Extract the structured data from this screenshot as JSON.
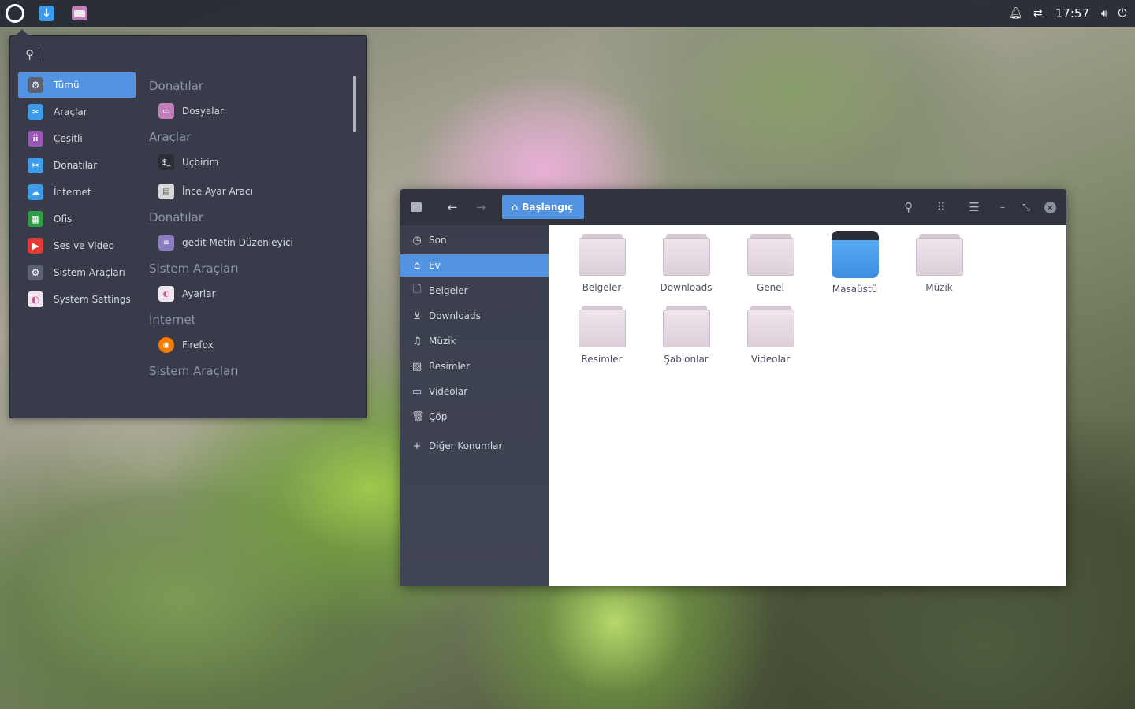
{
  "panel": {
    "clock": "17:57",
    "launchers": [
      {
        "name": "downloads-launcher",
        "icon": "arrow-down-icon"
      },
      {
        "name": "files-launcher",
        "icon": "file-manager-icon"
      }
    ],
    "tray_icons": [
      "bell-icon",
      "network-icon",
      "volume-icon",
      "power-icon"
    ]
  },
  "menu": {
    "search_value": "",
    "categories": [
      {
        "label": "Tümü",
        "icon": "gear-icon",
        "color": "#5b6170",
        "active": true
      },
      {
        "label": "Araçlar",
        "icon": "scissors-icon",
        "color": "#3d9be9"
      },
      {
        "label": "Çeşitli",
        "icon": "grid-icon",
        "color": "#9b59b6"
      },
      {
        "label": "Donatılar",
        "icon": "scissors-icon",
        "color": "#3d9be9"
      },
      {
        "label": "İnternet",
        "icon": "cloud-icon",
        "color": "#3d9be9"
      },
      {
        "label": "Ofis",
        "icon": "spreadsheet-icon",
        "color": "#2e9e44"
      },
      {
        "label": "Ses ve Video",
        "icon": "play-icon",
        "color": "#e53935"
      },
      {
        "label": "Sistem Araçları",
        "icon": "gear-icon",
        "color": "#5b6170"
      },
      {
        "label": "System Settings",
        "icon": "toggle-icon",
        "color": "#f1e5f0"
      }
    ],
    "groups": [
      {
        "title": "Donatılar",
        "apps": [
          {
            "label": "Dosyalar",
            "icon": "file-manager-icon",
            "color": "#c07fb8"
          }
        ]
      },
      {
        "title": "Araçlar",
        "apps": [
          {
            "label": "Uçbirim",
            "icon": "terminal-icon",
            "color": "#2b2e37"
          },
          {
            "label": "İnce Ayar Aracı",
            "icon": "tweak-icon",
            "color": "#d8d8d8"
          }
        ]
      },
      {
        "title": "Donatılar",
        "apps": [
          {
            "label": "gedit Metin Düzenleyici",
            "icon": "text-editor-icon",
            "color": "#8e7cc3"
          }
        ]
      },
      {
        "title": "Sistem Araçları",
        "apps": [
          {
            "label": "Ayarlar",
            "icon": "settings-toggle-icon",
            "color": "#f1e5f0"
          }
        ]
      },
      {
        "title": "İnternet",
        "apps": [
          {
            "label": "Firefox",
            "icon": "firefox-icon",
            "color": "#f57c00"
          }
        ]
      },
      {
        "title": "Sistem Araçları",
        "apps": []
      }
    ]
  },
  "filemanager": {
    "path_button": "Başlangıç",
    "places": [
      {
        "label": "Son",
        "icon": "clock-icon"
      },
      {
        "label": "Ev",
        "icon": "home-icon",
        "active": true
      },
      {
        "label": "Belgeler",
        "icon": "document-icon"
      },
      {
        "label": "Downloads",
        "icon": "download-icon"
      },
      {
        "label": "Müzik",
        "icon": "music-icon"
      },
      {
        "label": "Resimler",
        "icon": "image-icon"
      },
      {
        "label": "Videolar",
        "icon": "video-icon"
      },
      {
        "label": "Çöp",
        "icon": "trash-icon"
      }
    ],
    "other_locations": "Diğer Konumlar",
    "files": [
      {
        "label": "Belgeler",
        "type": "folder"
      },
      {
        "label": "Downloads",
        "type": "folder"
      },
      {
        "label": "Genel",
        "type": "folder"
      },
      {
        "label": "Masaüstü",
        "type": "desktop"
      },
      {
        "label": "Müzik",
        "type": "folder"
      },
      {
        "label": "Resimler",
        "type": "folder"
      },
      {
        "label": "Şablonlar",
        "type": "folder"
      },
      {
        "label": "Videolar",
        "type": "folder"
      }
    ]
  }
}
